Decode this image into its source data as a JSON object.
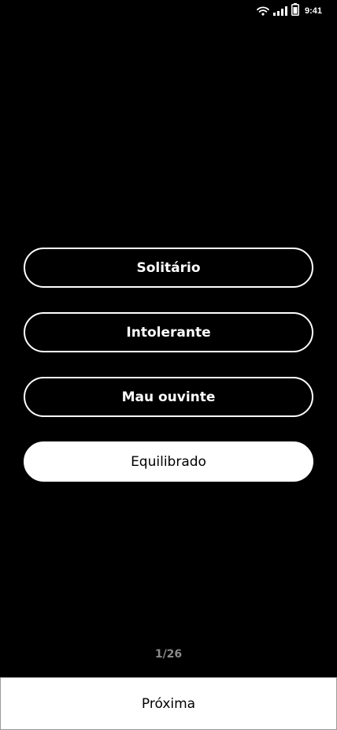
{
  "status_bar": {
    "time": "9:41",
    "icons": [
      "wifi-icon",
      "signal-icon",
      "battery-icon"
    ]
  },
  "options": [
    {
      "label": "Solitário",
      "selected": false
    },
    {
      "label": "Intolerante",
      "selected": false
    },
    {
      "label": "Mau ouvinte",
      "selected": false
    },
    {
      "label": "Equilibrado",
      "selected": true
    }
  ],
  "progress": {
    "text": "1/26",
    "current": 1,
    "total": 26
  },
  "footer": {
    "next_label": "Próxima"
  },
  "colors": {
    "background": "#000000",
    "foreground": "#ffffff",
    "progress_text": "#8a8a8a"
  }
}
